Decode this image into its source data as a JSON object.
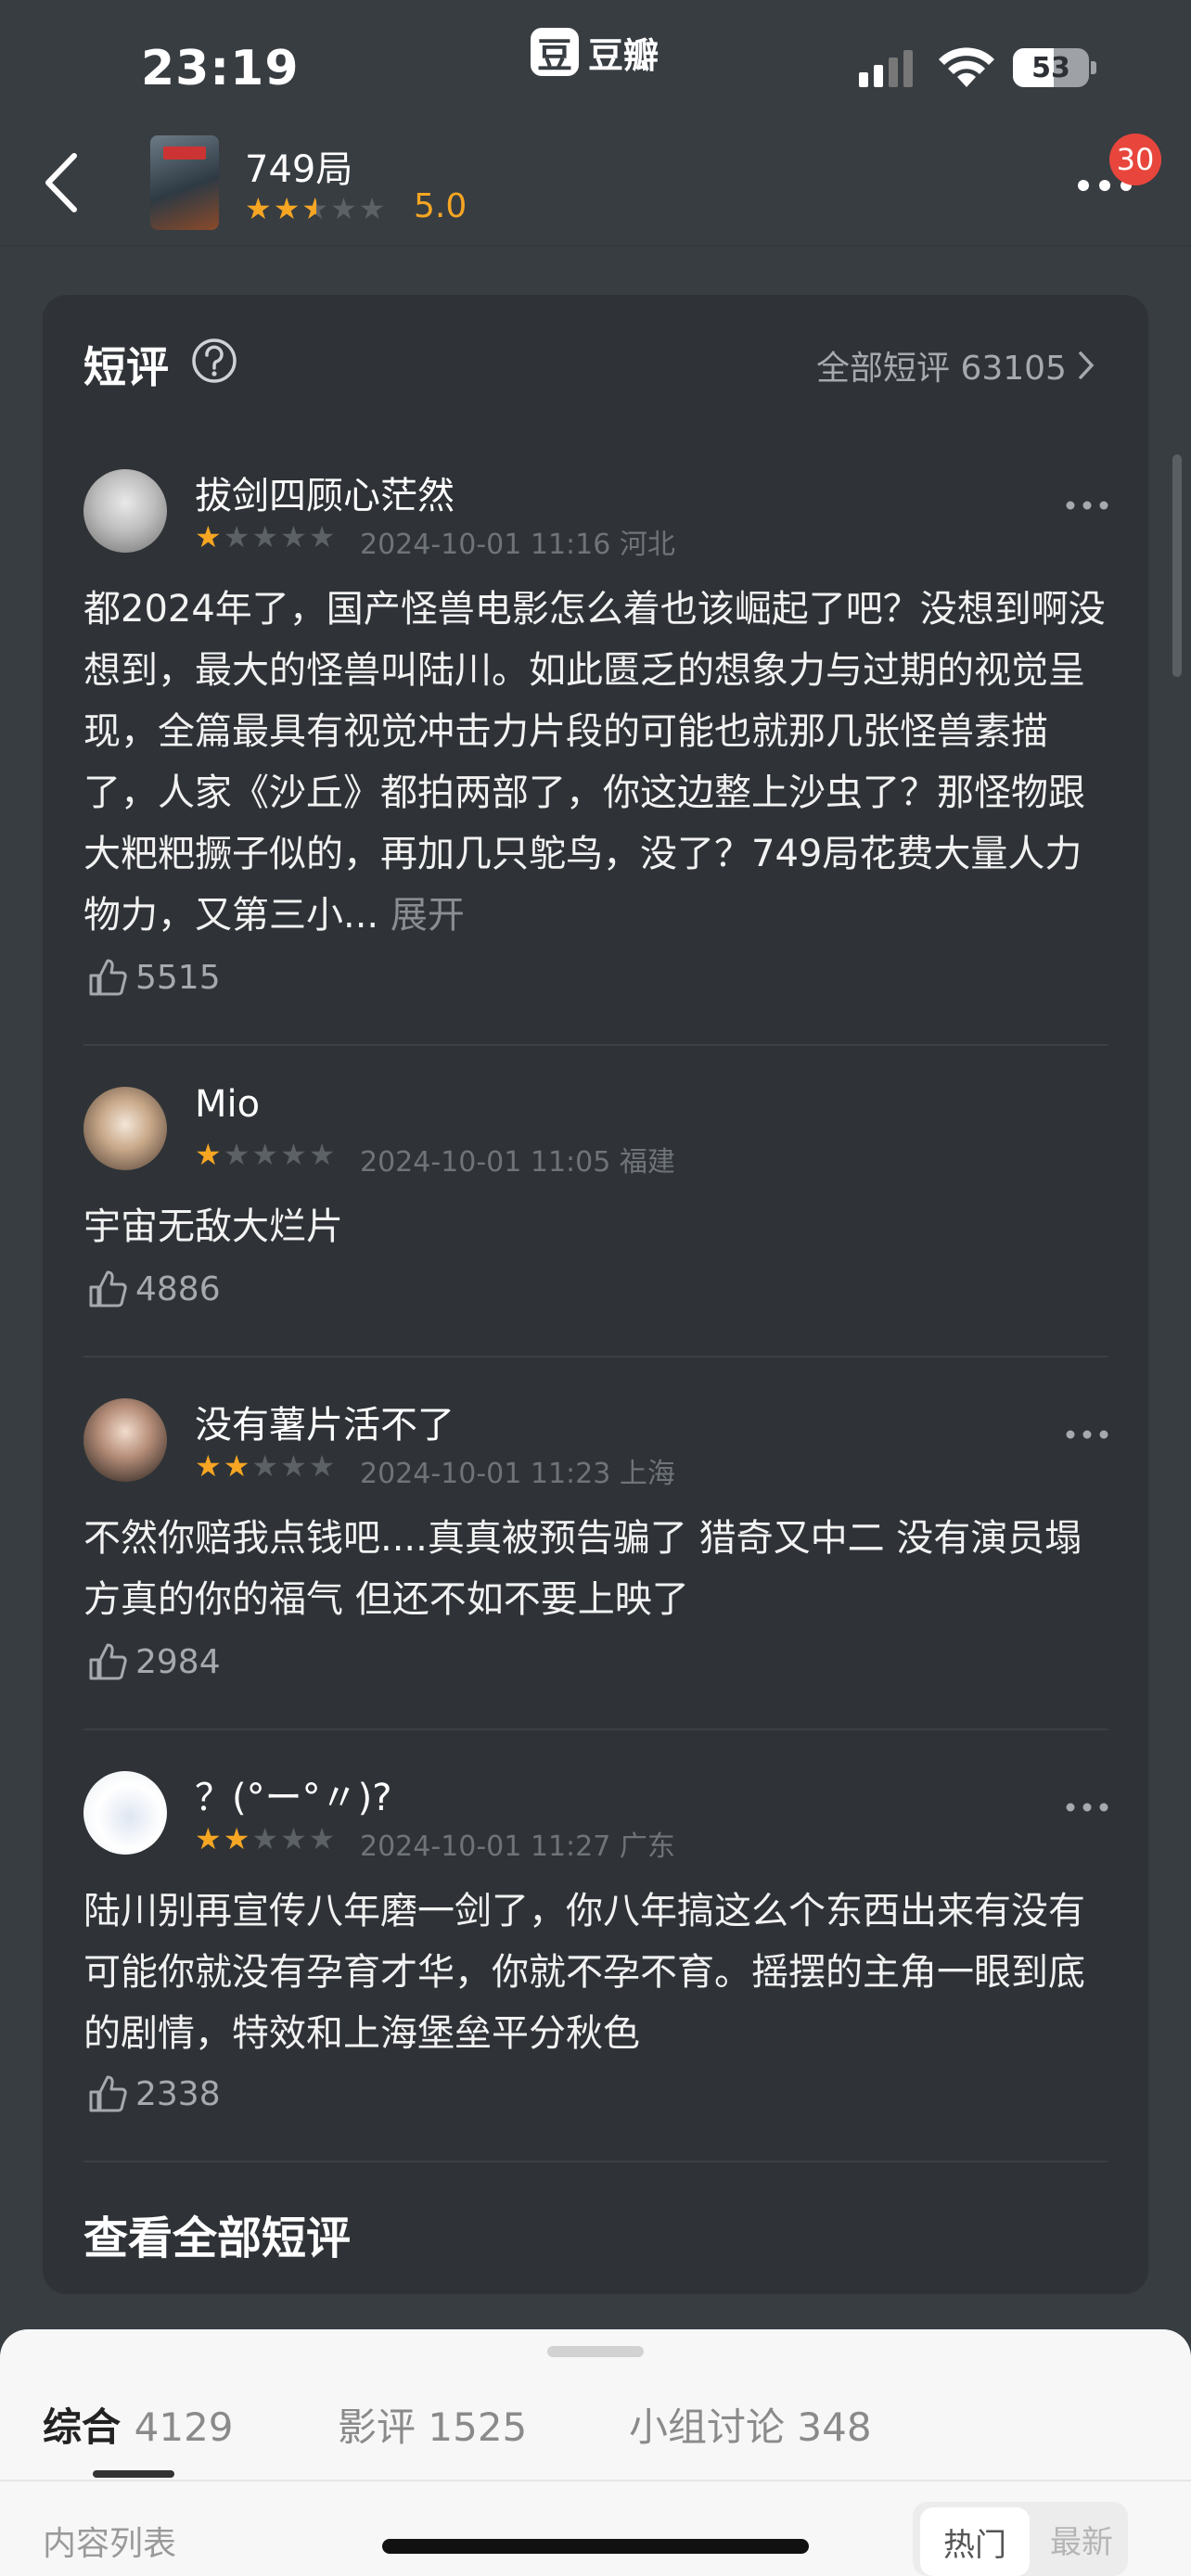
{
  "status_bar": {
    "time": "23:19",
    "app_logo": "豆",
    "app_name": "豆瓣",
    "battery": "53"
  },
  "header": {
    "title": "749局",
    "rating_stars": "★★★★★",
    "score": "5.0",
    "badge": "30"
  },
  "section": {
    "title": "短评",
    "all_link": "全部短评 63105",
    "see_all": "查看全部短评"
  },
  "reviews": [
    {
      "user": "拔剑四顾心茫然",
      "stars_filled": "★",
      "stars_empty": "★★★★",
      "rating": 1,
      "meta": "2024-10-01 11:16 河北",
      "text": "都2024年了，国产怪兽电影怎么着也该崛起了吧？没想到啊没想到，最大的怪兽叫陆川。如此匮乏的想象力与过期的视觉呈现，全篇最具有视觉冲击力片段的可能也就那几张怪兽素描了，人家《沙丘》都拍两部了，你这边整上沙虫了？那怪物跟大粑粑撅子似的，再加几只鸵鸟，没了？749局花费大量人力物力，又第三小...",
      "expand": "展开",
      "likes": "5515"
    },
    {
      "user": "Mio",
      "stars_filled": "★",
      "stars_empty": "★★★★",
      "rating": 1,
      "meta": "2024-10-01 11:05 福建",
      "text": "宇宙无敌大烂片",
      "likes": "4886"
    },
    {
      "user": "没有薯片活不了",
      "stars_filled": "★★",
      "stars_empty": "★★★",
      "rating": 2,
      "meta": "2024-10-01 11:23 上海",
      "text": "不然你赔我点钱吧....真真被预告骗了 猎奇又中二 没有演员塌方真的你的福气 但还不如不要上映了",
      "likes": "2984"
    },
    {
      "user": "？(°ー°〃)?",
      "stars_filled": "★★",
      "stars_empty": "★★★",
      "rating": 2,
      "meta": "2024-10-01 11:27 广东",
      "text": "陆川别再宣传八年磨一剑了，你八年搞这么个东西出来有没有可能你就没有孕育才华，你就不孕不育。摇摆的主角一眼到底的剧情，特效和上海堡垒平分秋色",
      "likes": "2338"
    }
  ],
  "tabs": [
    {
      "label": "综合",
      "count": "4129"
    },
    {
      "label": "影评",
      "count": "1525"
    },
    {
      "label": "小组讨论",
      "count": "348"
    }
  ],
  "content_list": "内容列表",
  "sort": {
    "hot": "热门",
    "new": "最新"
  },
  "colors": {
    "accent": "#f6a623",
    "star_empty": "#5c6166",
    "badge": "#e8463c"
  },
  "icons": [
    "back-icon",
    "signal-icon",
    "wifi-icon",
    "battery-icon",
    "more-icon",
    "help-icon",
    "chevron-right-icon",
    "thumb-up-icon"
  ]
}
